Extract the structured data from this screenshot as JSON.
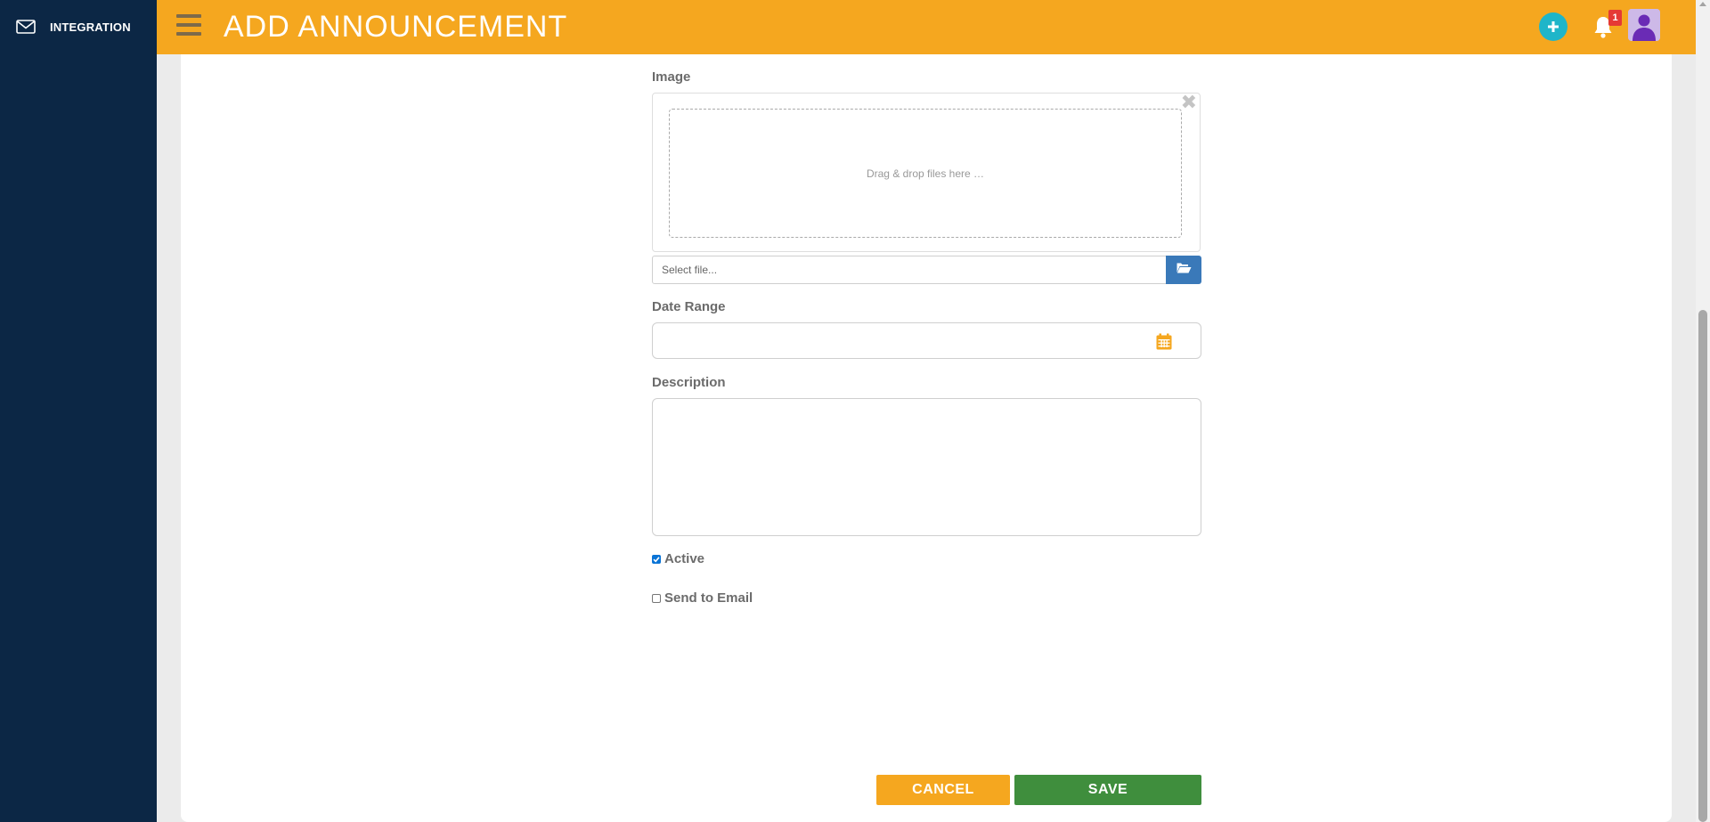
{
  "sidebar": {
    "items": [
      {
        "label": "INTEGRATION",
        "icon": "mail-icon"
      }
    ],
    "background": "#0c2745"
  },
  "header": {
    "title": "ADD ANNOUNCEMENT",
    "background": "#f5a71f",
    "notification_count": "1",
    "icons": [
      "menu-icon",
      "add-circle-icon",
      "bell-icon",
      "avatar-icon"
    ]
  },
  "form": {
    "image": {
      "label": "Image",
      "dropzone_text": "Drag & drop files here …",
      "file_placeholder": "Select file..."
    },
    "date_range": {
      "label": "Date Range",
      "value": ""
    },
    "description": {
      "label": "Description",
      "value": ""
    },
    "active": {
      "label": "Active",
      "checked": true
    },
    "send_email": {
      "label": "Send to Email",
      "checked": false
    }
  },
  "actions": {
    "cancel_label": "CANCEL",
    "save_label": "SAVE",
    "cancel_color": "#f5a71f",
    "save_color": "#3f8e3d"
  }
}
